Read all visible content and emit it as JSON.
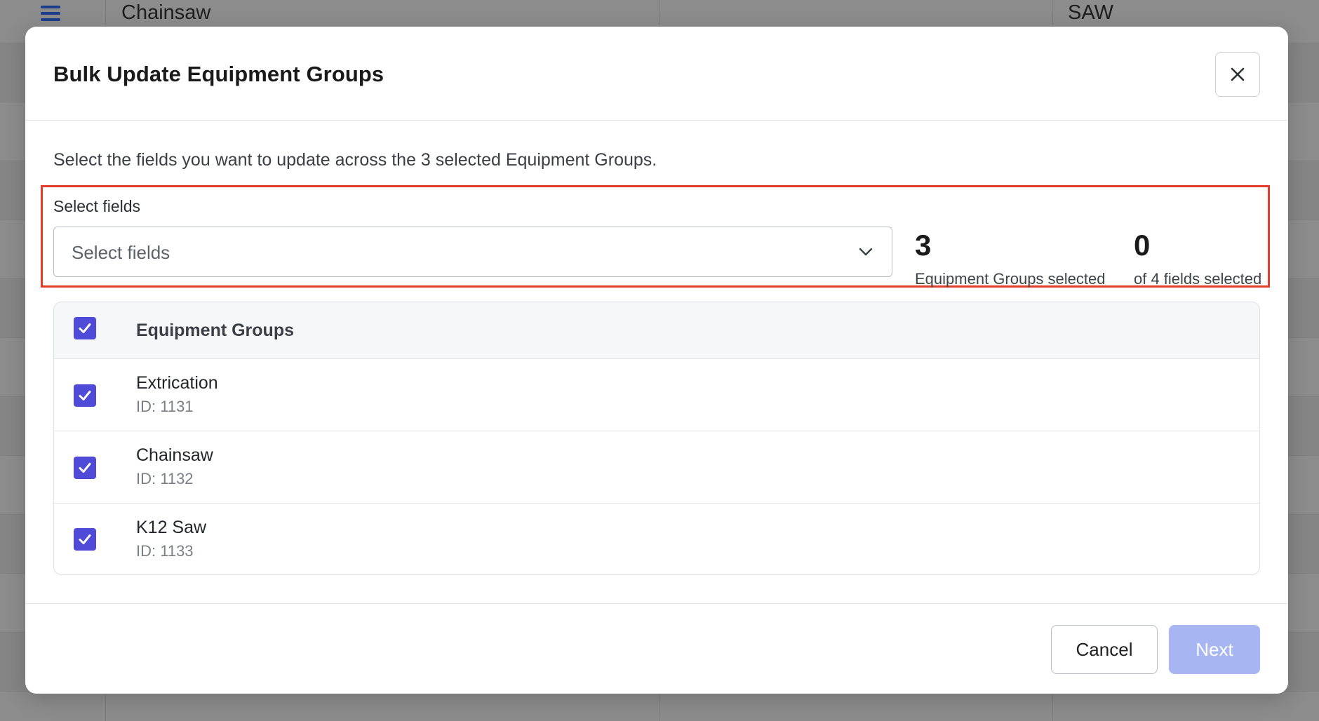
{
  "background": {
    "row1_name": "Chainsaw",
    "row1_code": "SAW"
  },
  "modal": {
    "title": "Bulk Update Equipment Groups",
    "intro": "Select the fields you want to update across the 3 selected Equipment Groups.",
    "select_label": "Select fields",
    "select_placeholder": "Select fields",
    "stats": {
      "groups_count": "3",
      "groups_label": "Equipment Groups selected",
      "fields_count": "0",
      "fields_label": "of 4 fields selected"
    },
    "table": {
      "header": "Equipment Groups",
      "header_checked": true,
      "rows": [
        {
          "name": "Extrication",
          "id": "ID: 1131",
          "checked": true
        },
        {
          "name": "Chainsaw",
          "id": "ID: 1132",
          "checked": true
        },
        {
          "name": "K12 Saw",
          "id": "ID: 1133",
          "checked": true
        }
      ]
    },
    "footer": {
      "cancel_label": "Cancel",
      "next_label": "Next"
    }
  },
  "colors": {
    "accent": "#4f4ad8",
    "highlight_border": "#e23c2a",
    "next_disabled": "#a7b6f3"
  },
  "icons": {
    "menu": "hamburger-icon",
    "close": "close-icon",
    "select_chevron": "chevron-down-icon",
    "checkbox": "checkmark-icon"
  }
}
